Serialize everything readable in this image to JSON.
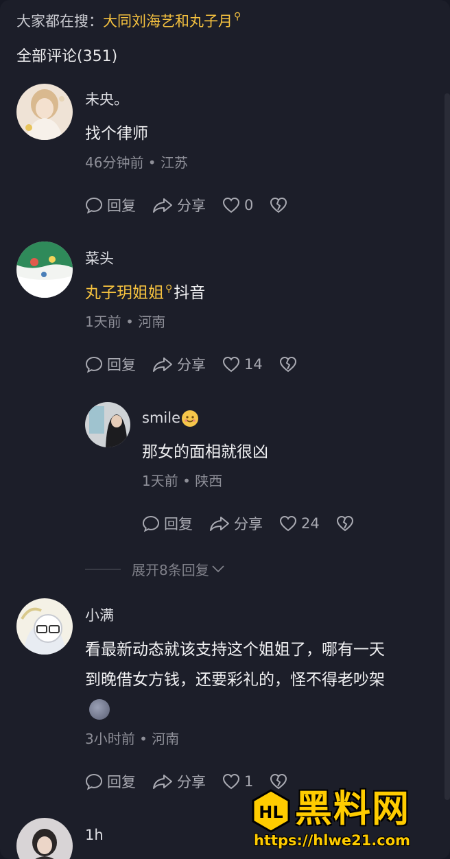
{
  "hot_search": {
    "label": "大家都在搜：",
    "keyword": "大同刘海艺和丸子月"
  },
  "comments_header": {
    "title": "全部评论(351)"
  },
  "comments": [
    {
      "username": "未央。",
      "text": "找个律师",
      "meta": "46分钟前 • 江苏",
      "reply_label": "回复",
      "share_label": "分享",
      "likes": "0"
    },
    {
      "username": "菜头",
      "keyword": "丸子玥姐姐",
      "text_suffix": "抖音",
      "meta": "1天前 • 河南",
      "reply_label": "回复",
      "share_label": "分享",
      "likes": "14"
    },
    {
      "username": "smile",
      "text": "那女的面相就很凶",
      "meta": "1天前 • 陕西",
      "reply_label": "回复",
      "share_label": "分享",
      "likes": "24"
    },
    {
      "username": "小满",
      "text_line1": "看最新动态就该支持这个姐姐了，哪有一天",
      "text_line2": "到晚借女方钱，还要彩礼的，怪不得老吵架",
      "meta": "3小时前 • 河南",
      "reply_label": "回复",
      "share_label": "分享",
      "likes": "1"
    },
    {
      "username": "1h"
    }
  ],
  "expand_replies": {
    "label": "展开8条回复"
  },
  "watermark": {
    "title": "黑料网",
    "url": "https://hlwe21.com"
  },
  "colors": {
    "background": "#1c1e29",
    "keyword": "#f6c23f",
    "muted": "#8e8f98"
  }
}
